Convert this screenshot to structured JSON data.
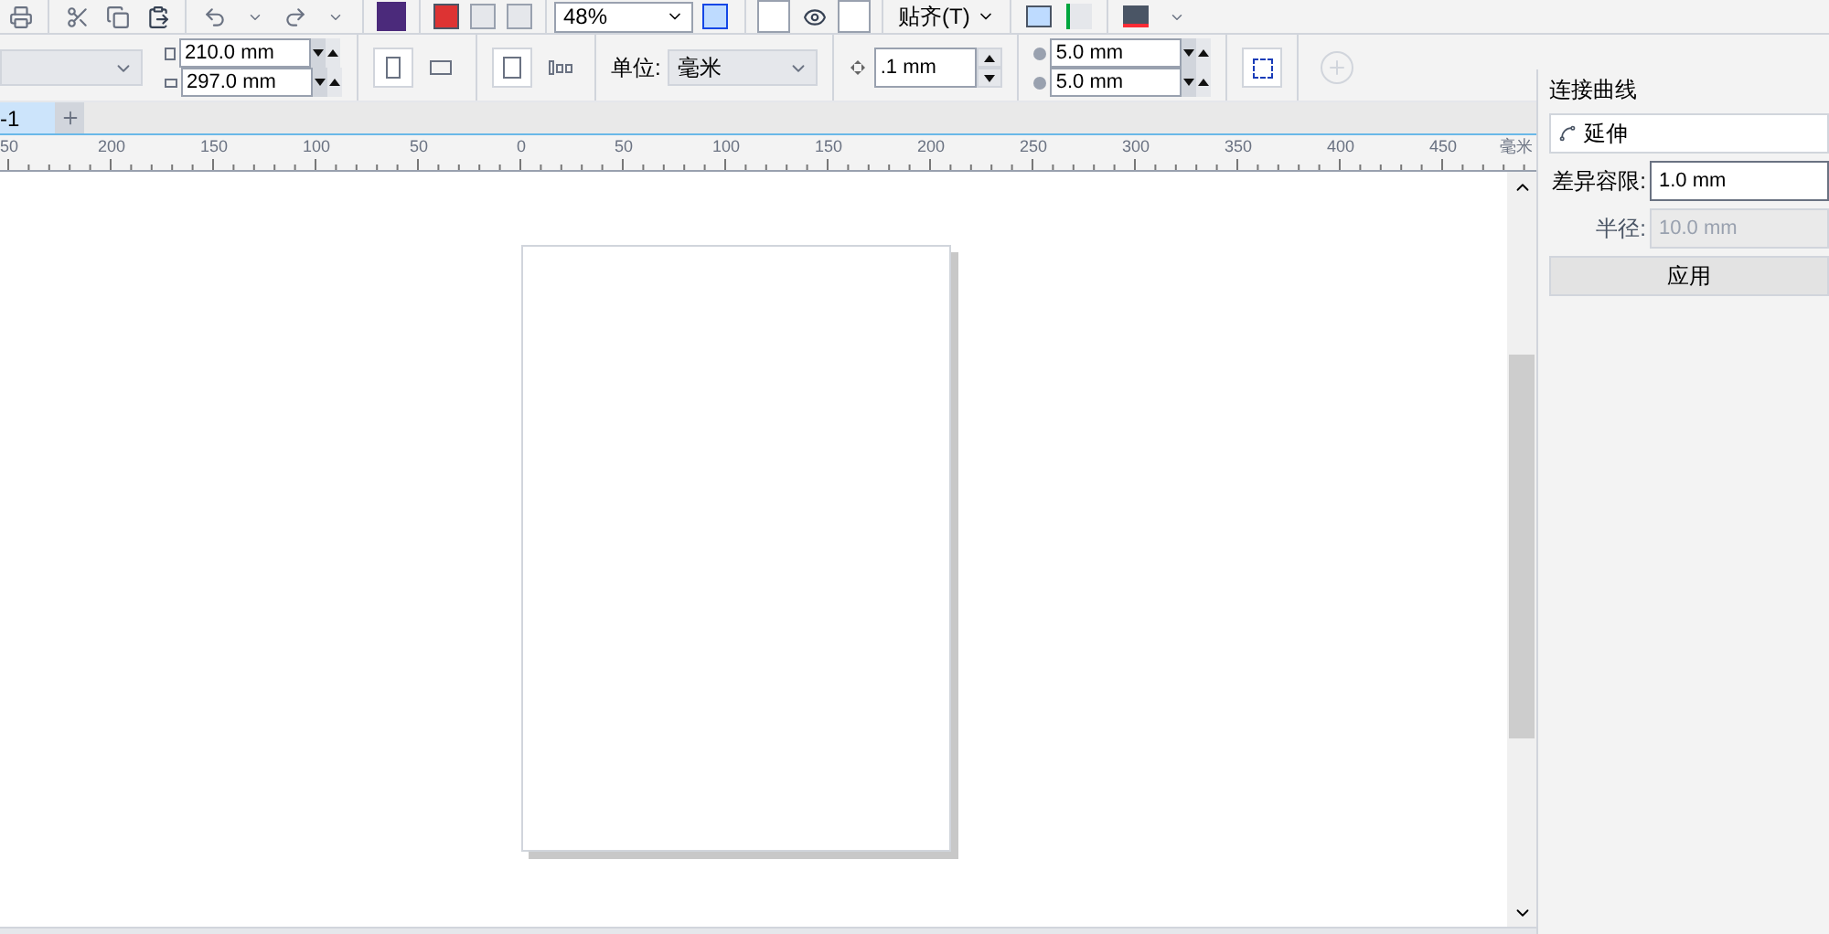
{
  "toolbar": {
    "zoom": "48%",
    "snap_menu": "贴齐(T)"
  },
  "property_bar": {
    "width": "210.0 mm",
    "height": "297.0 mm",
    "units_label": "单位:",
    "units": "毫米",
    "nudge": ".1 mm",
    "duplicate_x": "5.0 mm",
    "duplicate_y": "5.0 mm"
  },
  "document_tabs": [
    {
      "label": "-1",
      "selected": true
    }
  ],
  "ruler": {
    "labels": [
      "50",
      "200",
      "150",
      "100",
      "50",
      "0",
      "50",
      "100",
      "150",
      "200",
      "250",
      "300",
      "350",
      "400",
      "450"
    ],
    "unit": "毫米"
  },
  "docker": {
    "title": "连接曲线",
    "mode": "延伸",
    "fields": [
      {
        "label": "差异容限:",
        "value": "1.0 mm",
        "disabled": false
      },
      {
        "label": "半径:",
        "value": "10.0 mm",
        "disabled": true
      }
    ],
    "apply_button": "应用"
  }
}
